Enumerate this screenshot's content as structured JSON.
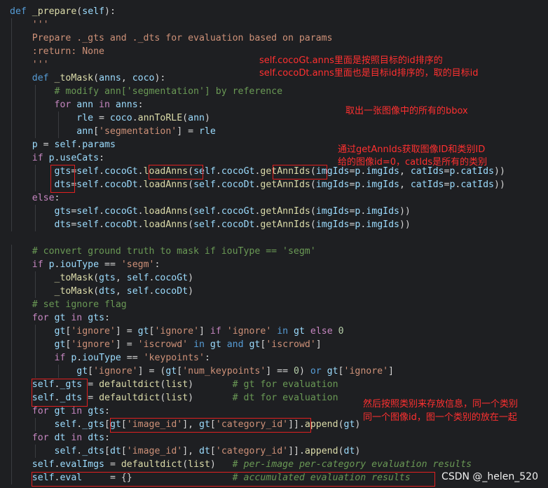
{
  "lines": [
    [
      {
        "c": "kw",
        "t": "def "
      },
      {
        "c": "fn",
        "t": "_prepare"
      },
      {
        "c": "op",
        "t": "("
      },
      {
        "c": "var",
        "t": "self"
      },
      {
        "c": "op",
        "t": "):"
      }
    ],
    [
      {
        "c": "doc",
        "t": "    '''"
      }
    ],
    [
      {
        "c": "doc",
        "t": "    Prepare ._gts and ._dts for evaluation based on params"
      }
    ],
    [
      {
        "c": "doc",
        "t": "    :return: None"
      }
    ],
    [
      {
        "c": "doc",
        "t": "    '''"
      }
    ],
    [
      {
        "c": "kw",
        "t": "    def "
      },
      {
        "c": "fn",
        "t": "_toMask"
      },
      {
        "c": "op",
        "t": "("
      },
      {
        "c": "var",
        "t": "anns"
      },
      {
        "c": "op",
        "t": ", "
      },
      {
        "c": "var",
        "t": "coco"
      },
      {
        "c": "op",
        "t": "):"
      }
    ],
    [
      {
        "c": "cm",
        "t": "        # modify ann['segmentation'] by reference"
      }
    ],
    [
      {
        "c": "kw2",
        "t": "        for "
      },
      {
        "c": "var",
        "t": "ann"
      },
      {
        "c": "kw2",
        "t": " in "
      },
      {
        "c": "var",
        "t": "anns"
      },
      {
        "c": "op",
        "t": ":"
      }
    ],
    [
      {
        "c": "var",
        "t": "            rle"
      },
      {
        "c": "op",
        "t": " = "
      },
      {
        "c": "var",
        "t": "coco"
      },
      {
        "c": "op",
        "t": "."
      },
      {
        "c": "fn",
        "t": "annToRLE"
      },
      {
        "c": "op",
        "t": "("
      },
      {
        "c": "var",
        "t": "ann"
      },
      {
        "c": "op",
        "t": ")"
      }
    ],
    [
      {
        "c": "var",
        "t": "            ann"
      },
      {
        "c": "op",
        "t": "["
      },
      {
        "c": "str",
        "t": "'segmentation'"
      },
      {
        "c": "op",
        "t": "] = "
      },
      {
        "c": "var",
        "t": "rle"
      }
    ],
    [
      {
        "c": "var",
        "t": "    p"
      },
      {
        "c": "op",
        "t": " = "
      },
      {
        "c": "var",
        "t": "self"
      },
      {
        "c": "op",
        "t": "."
      },
      {
        "c": "var",
        "t": "params"
      }
    ],
    [
      {
        "c": "kw2",
        "t": "    if "
      },
      {
        "c": "var",
        "t": "p"
      },
      {
        "c": "op",
        "t": "."
      },
      {
        "c": "var",
        "t": "useCats"
      },
      {
        "c": "op",
        "t": ":"
      }
    ],
    [
      {
        "c": "var",
        "t": "        gts"
      },
      {
        "c": "op",
        "t": "="
      },
      {
        "c": "var",
        "t": "self"
      },
      {
        "c": "op",
        "t": "."
      },
      {
        "c": "var",
        "t": "cocoGt"
      },
      {
        "c": "op",
        "t": "."
      },
      {
        "c": "fn",
        "t": "loadAnns"
      },
      {
        "c": "op",
        "t": "("
      },
      {
        "c": "var",
        "t": "self"
      },
      {
        "c": "op",
        "t": "."
      },
      {
        "c": "var",
        "t": "cocoGt"
      },
      {
        "c": "op",
        "t": "."
      },
      {
        "c": "fn",
        "t": "getAnnIds"
      },
      {
        "c": "op",
        "t": "("
      },
      {
        "c": "var",
        "t": "imgIds"
      },
      {
        "c": "op",
        "t": "="
      },
      {
        "c": "var",
        "t": "p"
      },
      {
        "c": "op",
        "t": "."
      },
      {
        "c": "var",
        "t": "imgIds"
      },
      {
        "c": "op",
        "t": ", "
      },
      {
        "c": "var",
        "t": "catIds"
      },
      {
        "c": "op",
        "t": "="
      },
      {
        "c": "var",
        "t": "p"
      },
      {
        "c": "op",
        "t": "."
      },
      {
        "c": "var",
        "t": "catIds"
      },
      {
        "c": "op",
        "t": "))"
      }
    ],
    [
      {
        "c": "var",
        "t": "        dts"
      },
      {
        "c": "op",
        "t": "="
      },
      {
        "c": "var",
        "t": "self"
      },
      {
        "c": "op",
        "t": "."
      },
      {
        "c": "var",
        "t": "cocoDt"
      },
      {
        "c": "op",
        "t": "."
      },
      {
        "c": "fn",
        "t": "loadAnns"
      },
      {
        "c": "op",
        "t": "("
      },
      {
        "c": "var",
        "t": "self"
      },
      {
        "c": "op",
        "t": "."
      },
      {
        "c": "var",
        "t": "cocoDt"
      },
      {
        "c": "op",
        "t": "."
      },
      {
        "c": "fn",
        "t": "getAnnIds"
      },
      {
        "c": "op",
        "t": "("
      },
      {
        "c": "var",
        "t": "imgIds"
      },
      {
        "c": "op",
        "t": "="
      },
      {
        "c": "var",
        "t": "p"
      },
      {
        "c": "op",
        "t": "."
      },
      {
        "c": "var",
        "t": "imgIds"
      },
      {
        "c": "op",
        "t": ", "
      },
      {
        "c": "var",
        "t": "catIds"
      },
      {
        "c": "op",
        "t": "="
      },
      {
        "c": "var",
        "t": "p"
      },
      {
        "c": "op",
        "t": "."
      },
      {
        "c": "var",
        "t": "catIds"
      },
      {
        "c": "op",
        "t": "))"
      }
    ],
    [
      {
        "c": "kw2",
        "t": "    else"
      },
      {
        "c": "op",
        "t": ":"
      }
    ],
    [
      {
        "c": "var",
        "t": "        gts"
      },
      {
        "c": "op",
        "t": "="
      },
      {
        "c": "var",
        "t": "self"
      },
      {
        "c": "op",
        "t": "."
      },
      {
        "c": "var",
        "t": "cocoGt"
      },
      {
        "c": "op",
        "t": "."
      },
      {
        "c": "fn",
        "t": "loadAnns"
      },
      {
        "c": "op",
        "t": "("
      },
      {
        "c": "var",
        "t": "self"
      },
      {
        "c": "op",
        "t": "."
      },
      {
        "c": "var",
        "t": "cocoGt"
      },
      {
        "c": "op",
        "t": "."
      },
      {
        "c": "fn",
        "t": "getAnnIds"
      },
      {
        "c": "op",
        "t": "("
      },
      {
        "c": "var",
        "t": "imgIds"
      },
      {
        "c": "op",
        "t": "="
      },
      {
        "c": "var",
        "t": "p"
      },
      {
        "c": "op",
        "t": "."
      },
      {
        "c": "var",
        "t": "imgIds"
      },
      {
        "c": "op",
        "t": "))"
      }
    ],
    [
      {
        "c": "var",
        "t": "        dts"
      },
      {
        "c": "op",
        "t": "="
      },
      {
        "c": "var",
        "t": "self"
      },
      {
        "c": "op",
        "t": "."
      },
      {
        "c": "var",
        "t": "cocoDt"
      },
      {
        "c": "op",
        "t": "."
      },
      {
        "c": "fn",
        "t": "loadAnns"
      },
      {
        "c": "op",
        "t": "("
      },
      {
        "c": "var",
        "t": "self"
      },
      {
        "c": "op",
        "t": "."
      },
      {
        "c": "var",
        "t": "cocoDt"
      },
      {
        "c": "op",
        "t": "."
      },
      {
        "c": "fn",
        "t": "getAnnIds"
      },
      {
        "c": "op",
        "t": "("
      },
      {
        "c": "var",
        "t": "imgIds"
      },
      {
        "c": "op",
        "t": "="
      },
      {
        "c": "var",
        "t": "p"
      },
      {
        "c": "op",
        "t": "."
      },
      {
        "c": "var",
        "t": "imgIds"
      },
      {
        "c": "op",
        "t": "))"
      }
    ],
    [],
    [
      {
        "c": "cm",
        "t": "    # convert ground truth to mask if iouType == 'segm'"
      }
    ],
    [
      {
        "c": "kw2",
        "t": "    if "
      },
      {
        "c": "var",
        "t": "p"
      },
      {
        "c": "op",
        "t": "."
      },
      {
        "c": "var",
        "t": "iouType"
      },
      {
        "c": "op",
        "t": " == "
      },
      {
        "c": "str",
        "t": "'segm'"
      },
      {
        "c": "op",
        "t": ":"
      }
    ],
    [
      {
        "c": "fn",
        "t": "        _toMask"
      },
      {
        "c": "op",
        "t": "("
      },
      {
        "c": "var",
        "t": "gts"
      },
      {
        "c": "op",
        "t": ", "
      },
      {
        "c": "var",
        "t": "self"
      },
      {
        "c": "op",
        "t": "."
      },
      {
        "c": "var",
        "t": "cocoGt"
      },
      {
        "c": "op",
        "t": ")"
      }
    ],
    [
      {
        "c": "fn",
        "t": "        _toMask"
      },
      {
        "c": "op",
        "t": "("
      },
      {
        "c": "var",
        "t": "dts"
      },
      {
        "c": "op",
        "t": ", "
      },
      {
        "c": "var",
        "t": "self"
      },
      {
        "c": "op",
        "t": "."
      },
      {
        "c": "var",
        "t": "cocoDt"
      },
      {
        "c": "op",
        "t": ")"
      }
    ],
    [
      {
        "c": "cm",
        "t": "    # set ignore flag"
      }
    ],
    [
      {
        "c": "kw2",
        "t": "    for "
      },
      {
        "c": "var",
        "t": "gt"
      },
      {
        "c": "kw2",
        "t": " in "
      },
      {
        "c": "var",
        "t": "gts"
      },
      {
        "c": "op",
        "t": ":"
      }
    ],
    [
      {
        "c": "var",
        "t": "        gt"
      },
      {
        "c": "op",
        "t": "["
      },
      {
        "c": "str",
        "t": "'ignore'"
      },
      {
        "c": "op",
        "t": "] = "
      },
      {
        "c": "var",
        "t": "gt"
      },
      {
        "c": "op",
        "t": "["
      },
      {
        "c": "str",
        "t": "'ignore'"
      },
      {
        "c": "op",
        "t": "] "
      },
      {
        "c": "kw2",
        "t": "if "
      },
      {
        "c": "str",
        "t": "'ignore'"
      },
      {
        "c": "kw",
        "t": " in "
      },
      {
        "c": "var",
        "t": "gt"
      },
      {
        "c": "kw2",
        "t": " else "
      },
      {
        "c": "num",
        "t": "0"
      }
    ],
    [
      {
        "c": "var",
        "t": "        gt"
      },
      {
        "c": "op",
        "t": "["
      },
      {
        "c": "str",
        "t": "'ignore'"
      },
      {
        "c": "op",
        "t": "] = "
      },
      {
        "c": "str",
        "t": "'iscrowd'"
      },
      {
        "c": "kw",
        "t": " in "
      },
      {
        "c": "var",
        "t": "gt"
      },
      {
        "c": "kw",
        "t": " and "
      },
      {
        "c": "var",
        "t": "gt"
      },
      {
        "c": "op",
        "t": "["
      },
      {
        "c": "str",
        "t": "'iscrowd'"
      },
      {
        "c": "op",
        "t": "]"
      }
    ],
    [
      {
        "c": "kw2",
        "t": "        if "
      },
      {
        "c": "var",
        "t": "p"
      },
      {
        "c": "op",
        "t": "."
      },
      {
        "c": "var",
        "t": "iouType"
      },
      {
        "c": "op",
        "t": " == "
      },
      {
        "c": "str",
        "t": "'keypoints'"
      },
      {
        "c": "op",
        "t": ":"
      }
    ],
    [
      {
        "c": "var",
        "t": "            gt"
      },
      {
        "c": "op",
        "t": "["
      },
      {
        "c": "str",
        "t": "'ignore'"
      },
      {
        "c": "op",
        "t": "] = ("
      },
      {
        "c": "var",
        "t": "gt"
      },
      {
        "c": "op",
        "t": "["
      },
      {
        "c": "str",
        "t": "'num_keypoints'"
      },
      {
        "c": "op",
        "t": "] == "
      },
      {
        "c": "num",
        "t": "0"
      },
      {
        "c": "op",
        "t": ") "
      },
      {
        "c": "kw",
        "t": "or "
      },
      {
        "c": "var",
        "t": "gt"
      },
      {
        "c": "op",
        "t": "["
      },
      {
        "c": "str",
        "t": "'ignore'"
      },
      {
        "c": "op",
        "t": "]"
      }
    ],
    [
      {
        "c": "var",
        "t": "    self"
      },
      {
        "c": "op",
        "t": "."
      },
      {
        "c": "var",
        "t": "_gts"
      },
      {
        "c": "op",
        "t": " = "
      },
      {
        "c": "fn",
        "t": "defaultdict"
      },
      {
        "c": "op",
        "t": "("
      },
      {
        "c": "fn",
        "t": "list"
      },
      {
        "c": "op",
        "t": ")       "
      },
      {
        "c": "cm",
        "t": "# gt for evaluation"
      }
    ],
    [
      {
        "c": "var",
        "t": "    self"
      },
      {
        "c": "op",
        "t": "."
      },
      {
        "c": "var",
        "t": "_dts"
      },
      {
        "c": "op",
        "t": " = "
      },
      {
        "c": "fn",
        "t": "defaultdict"
      },
      {
        "c": "op",
        "t": "("
      },
      {
        "c": "fn",
        "t": "list"
      },
      {
        "c": "op",
        "t": ")       "
      },
      {
        "c": "cm",
        "t": "# dt for evaluation"
      }
    ],
    [
      {
        "c": "kw2",
        "t": "    for "
      },
      {
        "c": "var",
        "t": "gt"
      },
      {
        "c": "kw2",
        "t": " in "
      },
      {
        "c": "var",
        "t": "gts"
      },
      {
        "c": "op",
        "t": ":"
      }
    ],
    [
      {
        "c": "var",
        "t": "        self"
      },
      {
        "c": "op",
        "t": "."
      },
      {
        "c": "var",
        "t": "_gts"
      },
      {
        "c": "op",
        "t": "["
      },
      {
        "c": "var",
        "t": "gt"
      },
      {
        "c": "op",
        "t": "["
      },
      {
        "c": "str",
        "t": "'image_id'"
      },
      {
        "c": "op",
        "t": "], "
      },
      {
        "c": "var",
        "t": "gt"
      },
      {
        "c": "op",
        "t": "["
      },
      {
        "c": "str",
        "t": "'category_id'"
      },
      {
        "c": "op",
        "t": "]]."
      },
      {
        "c": "fn",
        "t": "append"
      },
      {
        "c": "op",
        "t": "("
      },
      {
        "c": "var",
        "t": "gt"
      },
      {
        "c": "op",
        "t": ")"
      }
    ],
    [
      {
        "c": "kw2",
        "t": "    for "
      },
      {
        "c": "var",
        "t": "dt"
      },
      {
        "c": "kw2",
        "t": " in "
      },
      {
        "c": "var",
        "t": "dts"
      },
      {
        "c": "op",
        "t": ":"
      }
    ],
    [
      {
        "c": "var",
        "t": "        self"
      },
      {
        "c": "op",
        "t": "."
      },
      {
        "c": "var",
        "t": "_dts"
      },
      {
        "c": "op",
        "t": "["
      },
      {
        "c": "var",
        "t": "dt"
      },
      {
        "c": "op",
        "t": "["
      },
      {
        "c": "str",
        "t": "'image_id'"
      },
      {
        "c": "op",
        "t": "], "
      },
      {
        "c": "var",
        "t": "dt"
      },
      {
        "c": "op",
        "t": "["
      },
      {
        "c": "str",
        "t": "'category_id'"
      },
      {
        "c": "op",
        "t": "]]."
      },
      {
        "c": "fn",
        "t": "append"
      },
      {
        "c": "op",
        "t": "("
      },
      {
        "c": "var",
        "t": "dt"
      },
      {
        "c": "op",
        "t": ")"
      }
    ],
    [
      {
        "c": "var",
        "t": "    self"
      },
      {
        "c": "op",
        "t": "."
      },
      {
        "c": "var",
        "t": "evalImgs"
      },
      {
        "c": "op",
        "t": " = "
      },
      {
        "c": "fn",
        "t": "defaultdict"
      },
      {
        "c": "op",
        "t": "("
      },
      {
        "c": "fn",
        "t": "list"
      },
      {
        "c": "op",
        "t": ")   "
      },
      {
        "c": "cmi",
        "t": "# per-image per-category evaluation results"
      }
    ],
    [
      {
        "c": "var",
        "t": "    self"
      },
      {
        "c": "op",
        "t": "."
      },
      {
        "c": "var",
        "t": "eval"
      },
      {
        "c": "op",
        "t": "     = {}                  "
      },
      {
        "c": "cmi",
        "t": "# accumulated evaluation results"
      }
    ]
  ],
  "annotations": {
    "note1": "self.cocoGt.anns里面是按照目标的id排序的",
    "note2": "self.cocoDt.anns里面也是目标id排序的，取的目标id",
    "note3": "取出一张图像中的所有的bbox",
    "note4": "通过getAnnIds获取图像ID和类别ID",
    "note5": "给的图像id=0，catIds是所有的类别",
    "note6": "然后按照类别来存放信息，同一个类别",
    "note7": "同一个图像id，图一个类别的放在一起"
  },
  "watermark": "CSDN @_helen_520",
  "colors": {
    "background": "#1e1f22",
    "highlight_box": "#e02020",
    "annotation_text": "#ff3030"
  }
}
